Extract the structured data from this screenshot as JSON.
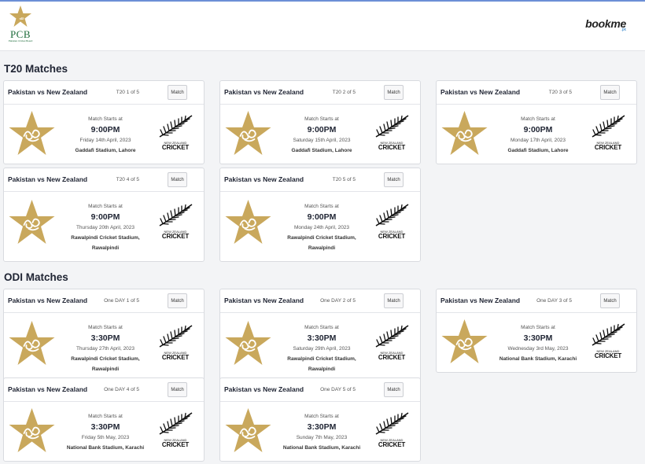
{
  "header": {
    "logo_text": "PCB",
    "logo_subtext": "Pakistan Cricket Board",
    "partner_name": "bookme",
    "partner_suffix": ".pk"
  },
  "labels": {
    "match_starts": "Match Starts at",
    "match_button": "Match",
    "nz_text": "NEW ZEALAND",
    "nz_cricket": "CRICKET"
  },
  "sections": [
    {
      "title": "T20 Matches",
      "matches": [
        {
          "title": "Pakistan vs New Zealand",
          "seq": "T20 1 of 5",
          "time": "9:00PM",
          "date": "Friday 14th April, 2023",
          "venue": "Gaddafi Stadium, Lahore"
        },
        {
          "title": "Pakistan vs New Zealand",
          "seq": "T20 2 of 5",
          "time": "9:00PM",
          "date": "Saturday 15th April, 2023",
          "venue": "Gaddafi Stadium, Lahore"
        },
        {
          "title": "Pakistan vs New Zealand",
          "seq": "T20 3 of 5",
          "time": "9:00PM",
          "date": "Monday 17th April, 2023",
          "venue": "Gaddafi Stadium, Lahore"
        },
        {
          "title": "Pakistan vs New Zealand",
          "seq": "T20 4 of 5",
          "time": "9:00PM",
          "date": "Thursday 20th April, 2023",
          "venue": "Rawalpindi Cricket Stadium, Rawalpindi"
        },
        {
          "title": "Pakistan vs New Zealand",
          "seq": "T20 5 of 5",
          "time": "9:00PM",
          "date": "Monday 24th April, 2023",
          "venue": "Rawalpindi Cricket Stadium, Rawalpindi"
        }
      ]
    },
    {
      "title": "ODI Matches",
      "matches": [
        {
          "title": "Pakistan vs New Zealand",
          "seq": "One DAY 1 of 5",
          "time": "3:30PM",
          "date": "Thursday 27th April, 2023",
          "venue": "Rawalpindi Cricket Stadium, Rawalpindi"
        },
        {
          "title": "Pakistan vs New Zealand",
          "seq": "One DAY 2 of 5",
          "time": "3:30PM",
          "date": "Saturday 29th April, 2023",
          "venue": "Rawalpindi Cricket Stadium, Rawalpindi"
        },
        {
          "title": "Pakistan vs New Zealand",
          "seq": "One DAY 3 of 5",
          "time": "3:30PM",
          "date": "Wednesday 3rd May, 2023",
          "venue": "National Bank Stadium, Karachi"
        },
        {
          "title": "Pakistan vs New Zealand",
          "seq": "One DAY 4 of 5",
          "time": "3:30PM",
          "date": "Friday 5th May, 2023",
          "venue": "National Bank Stadium, Karachi"
        },
        {
          "title": "Pakistan vs New Zealand",
          "seq": "One DAY 5 of 5",
          "time": "3:30PM",
          "date": "Sunday 7th May, 2023",
          "venue": "National Bank Stadium, Karachi"
        }
      ]
    }
  ],
  "colors": {
    "star_gold": "#c9a85c",
    "pcb_green": "#1d6b3a",
    "accent_blue": "#6c8fd6"
  },
  "icons": [
    "pcb-star-logo-icon",
    "pakistan-star-icon",
    "new-zealand-fern-icon"
  ]
}
